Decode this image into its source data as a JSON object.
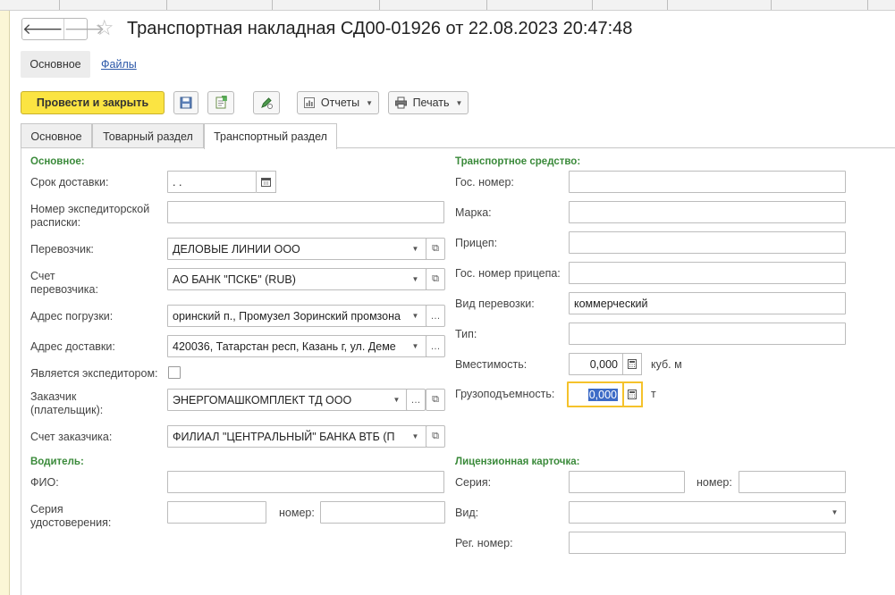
{
  "window": {
    "title": "Транспортная накладная СД00-01926 от 22.08.2023 20:47:48"
  },
  "nav": {
    "back_icon": "arrow-left-icon",
    "forward_icon": "arrow-right-icon",
    "favorite_icon": "star-icon"
  },
  "subnav": {
    "main": "Основное",
    "files": "Файлы"
  },
  "toolbar": {
    "post_close": "Провести и закрыть",
    "reports": "Отчеты",
    "print": "Печать"
  },
  "tabs": [
    {
      "label": "Основное"
    },
    {
      "label": "Товарный раздел"
    },
    {
      "label": "Транспортный раздел"
    }
  ],
  "left": {
    "section_main": "Основное:",
    "delivery_term": {
      "label": "Срок доставки:",
      "value": " .  ."
    },
    "forwarder_receipt": {
      "label": "Номер экспедиторской расписки:",
      "value": ""
    },
    "carrier": {
      "label": "Перевозчик:",
      "value": "ДЕЛОВЫЕ ЛИНИИ ООО"
    },
    "carrier_account": {
      "label": "Счет перевозчика:",
      "value": "АО БАНК \"ПСКБ\" (RUB)"
    },
    "loading_address": {
      "label": "Адрес погрузки:",
      "value": "оринский п., Промузел Зоринский промзона"
    },
    "delivery_address": {
      "label": "Адрес доставки:",
      "value": "420036, Татарстан респ, Казань г, ул. Деме"
    },
    "is_forwarder": {
      "label": "Является экспедитором:",
      "checked": false
    },
    "customer": {
      "label": "Заказчик (плательщик):",
      "value": "ЭНЕРГОМАШКОМПЛЕКТ ТД ООО"
    },
    "customer_account": {
      "label": "Счет заказчика:",
      "value": "ФИЛИАЛ \"ЦЕНТРАЛЬНЫЙ\" БАНКА ВТБ (П"
    },
    "section_driver": "Водитель:",
    "fio": {
      "label": "ФИО:",
      "value": ""
    },
    "id_series": {
      "label": "Серия удостоверения:",
      "value": ""
    },
    "id_number": {
      "label": "номер:",
      "value": ""
    }
  },
  "right": {
    "section_vehicle": "Транспортное средство:",
    "plate": {
      "label": "Гос. номер:",
      "value": ""
    },
    "brand": {
      "label": "Марка:",
      "value": ""
    },
    "trailer": {
      "label": "Прицеп:",
      "value": ""
    },
    "trailer_plate": {
      "label": "Гос. номер прицепа:",
      "value": ""
    },
    "transport_kind": {
      "label": "Вид перевозки:",
      "value": "коммерческий"
    },
    "type": {
      "label": "Тип:",
      "value": ""
    },
    "capacity": {
      "label": "Вместимость:",
      "value": "0,000",
      "unit": "куб. м"
    },
    "payload": {
      "label": "Грузоподъемность:",
      "value": "0,000",
      "unit": "т"
    },
    "section_license": "Лицензионная карточка:",
    "lic_series": {
      "label": "Серия:",
      "value": ""
    },
    "lic_number": {
      "label": "номер:",
      "value": ""
    },
    "lic_kind": {
      "label": "Вид:",
      "value": ""
    },
    "lic_reg": {
      "label": "Рег. номер:",
      "value": ""
    }
  },
  "colors": {
    "primary_button": "#fbe442",
    "section_header": "#3a8a3a",
    "link": "#2b57a8",
    "focus_border": "#f5c22b"
  }
}
